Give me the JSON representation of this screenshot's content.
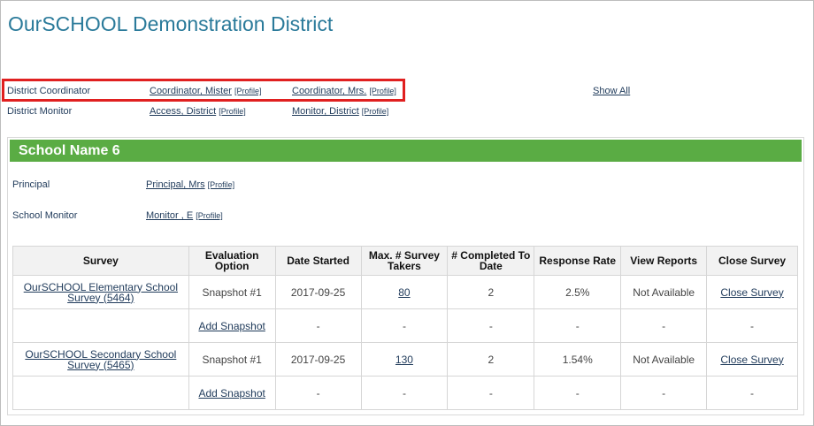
{
  "page": {
    "title": "OurSCHOOL Demonstration District"
  },
  "district": {
    "coordinator_label": "District Coordinator",
    "coordinators": [
      {
        "name": "Coordinator, Mister",
        "profile": "[Profile]"
      },
      {
        "name": "Coordinator, Mrs.",
        "profile": "[Profile]"
      }
    ],
    "show_all": "Show All",
    "monitor_label": "District Monitor",
    "monitors": [
      {
        "name": "Access, District",
        "profile": "[Profile]"
      },
      {
        "name": "Monitor, District",
        "profile": "[Profile]"
      }
    ]
  },
  "school": {
    "name": "School Name 6",
    "principal_label": "Principal",
    "principal": {
      "name": "Principal, Mrs",
      "profile": "[Profile]"
    },
    "monitor_label": "School Monitor",
    "monitor": {
      "name": "Monitor , E",
      "profile": "[Profile]"
    }
  },
  "table": {
    "headers": [
      "Survey",
      "Evaluation Option",
      "Date Started",
      "Max. # Survey Takers",
      "# Completed To Date",
      "Response Rate",
      "View Reports",
      "Close Survey"
    ],
    "rows": [
      {
        "survey": "OurSCHOOL Elementary School Survey (5464)",
        "option": "Snapshot #1",
        "date": "2017-09-25",
        "max": "80",
        "completed": "2",
        "rate": "2.5%",
        "reports": "Not Available",
        "close": "Close Survey"
      },
      {
        "survey": "",
        "option": "Add Snapshot",
        "date": "-",
        "max": "-",
        "completed": "-",
        "rate": "-",
        "reports": "-",
        "close": "-"
      },
      {
        "survey": "OurSCHOOL Secondary School Survey (5465)",
        "option": "Snapshot #1",
        "date": "2017-09-25",
        "max": "130",
        "completed": "2",
        "rate": "1.54%",
        "reports": "Not Available",
        "close": "Close Survey"
      },
      {
        "survey": "",
        "option": "Add Snapshot",
        "date": "-",
        "max": "-",
        "completed": "-",
        "rate": "-",
        "reports": "-",
        "close": "-"
      }
    ]
  },
  "colors": {
    "title": "#2a7a9a",
    "panel_header": "#5aac44",
    "highlight": "#e02020",
    "date": "#6a9b2a"
  }
}
